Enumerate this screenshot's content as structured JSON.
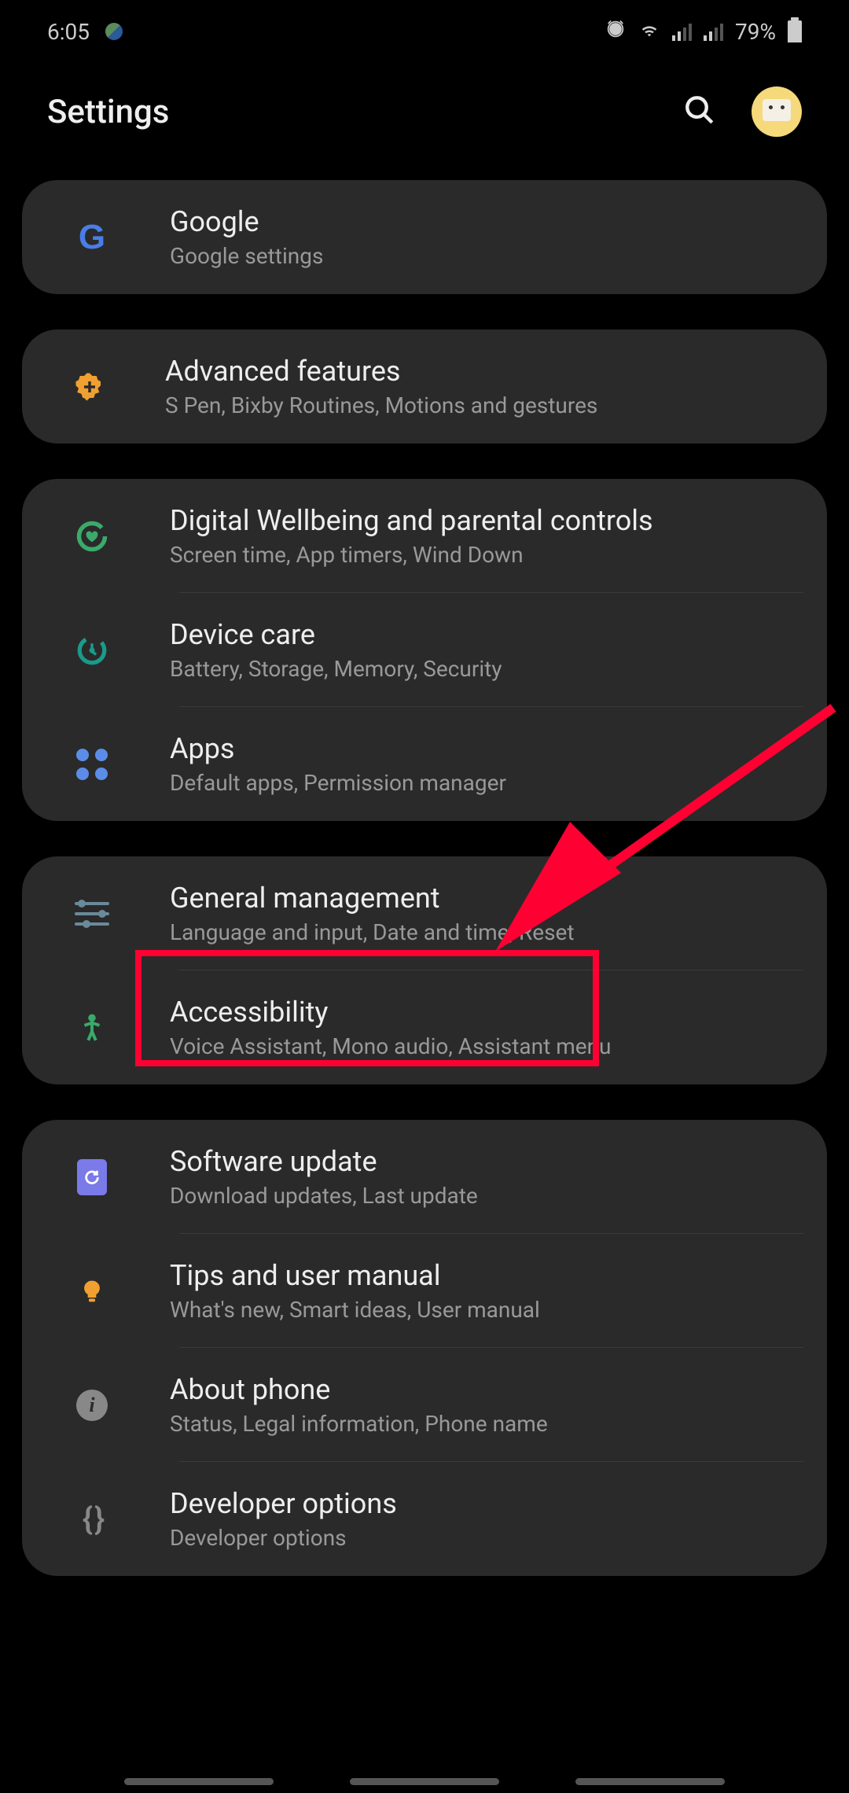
{
  "status": {
    "time": "6:05",
    "battery_pct": "79%"
  },
  "header": {
    "title": "Settings"
  },
  "groups": [
    {
      "items": [
        {
          "key": "google",
          "title": "Google",
          "subtitle": "Google settings"
        }
      ]
    },
    {
      "items": [
        {
          "key": "advanced",
          "title": "Advanced features",
          "subtitle": "S Pen, Bixby Routines, Motions and gestures"
        }
      ]
    },
    {
      "items": [
        {
          "key": "wellbeing",
          "title": "Digital Wellbeing and parental controls",
          "subtitle": "Screen time, App timers, Wind Down"
        },
        {
          "key": "devicecare",
          "title": "Device care",
          "subtitle": "Battery, Storage, Memory, Security"
        },
        {
          "key": "apps",
          "title": "Apps",
          "subtitle": "Default apps, Permission manager"
        }
      ]
    },
    {
      "items": [
        {
          "key": "general",
          "title": "General management",
          "subtitle": "Language and input, Date and time, Reset"
        },
        {
          "key": "accessibility",
          "title": "Accessibility",
          "subtitle": "Voice Assistant, Mono audio, Assistant menu"
        }
      ]
    },
    {
      "items": [
        {
          "key": "software",
          "title": "Software update",
          "subtitle": "Download updates, Last update"
        },
        {
          "key": "tips",
          "title": "Tips and user manual",
          "subtitle": "What's new, Smart ideas, User manual"
        },
        {
          "key": "about",
          "title": "About phone",
          "subtitle": "Status, Legal information, Phone name"
        },
        {
          "key": "developer",
          "title": "Developer options",
          "subtitle": "Developer options"
        }
      ]
    }
  ],
  "annotation": {
    "highlighted_item": "general"
  }
}
